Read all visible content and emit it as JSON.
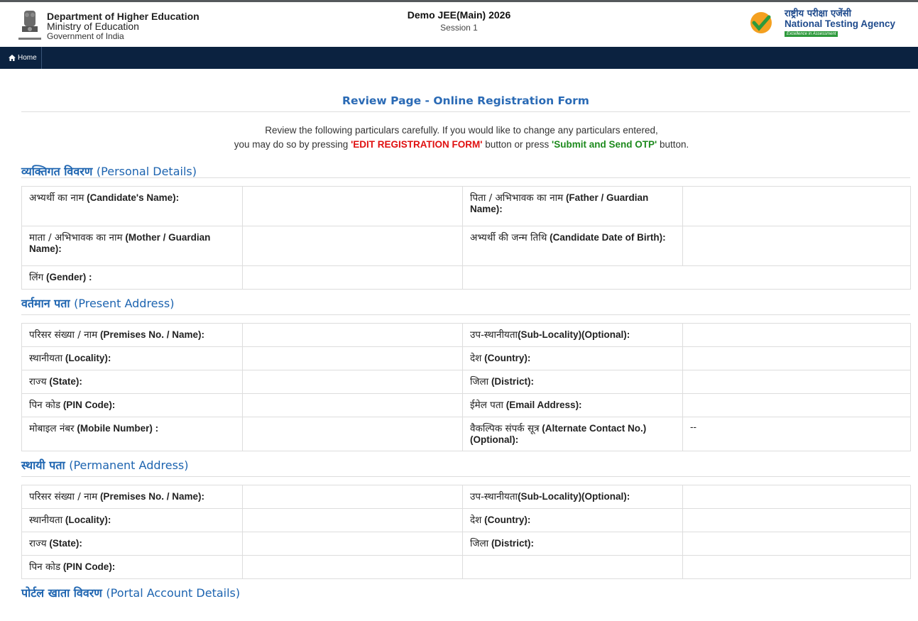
{
  "header": {
    "dept_line1": "Department of Higher Education",
    "dept_line2": "Ministry of Education",
    "dept_line3": "Government of India",
    "exam_title": "Demo JEE(Main) 2026",
    "session": "Session 1",
    "nta_hindi": "राष्ट्रीय परीक्षा एजेंसी",
    "nta_english": "National Testing Agency",
    "nta_tagline": "Excellence in Assessment"
  },
  "nav": {
    "home_label": "Home"
  },
  "page_title": "Review Page - Online Registration Form",
  "intro": {
    "line1": "Review the following particulars carefully. If you would like to change any particulars entered,",
    "line2_pre": "you may do so by pressing ",
    "edit_btn_text": "'EDIT REGISTRATION FORM'",
    "line2_mid": " button or press  ",
    "submit_btn_text": "'Submit and Send OTP'",
    "line2_post": " button."
  },
  "personal": {
    "heading_hi": "व्यक्तिगत विवरण",
    "heading_en": "(Personal Details)",
    "candidate_name_hi": "अभ्यर्थी का नाम",
    "candidate_name_en": "(Candidate's Name):",
    "father_hi": "पिता / अभिभावक का नाम",
    "father_en": "(Father / Guardian Name):",
    "mother_hi": "माता / अभिभावक का नाम",
    "mother_en": "(Mother / Guardian Name):",
    "dob_hi": "अभ्यर्थी की जन्म तिथि",
    "dob_en": "(Candidate Date of Birth):",
    "gender_hi": "लिंग",
    "gender_en": "(Gender) :"
  },
  "present": {
    "heading_hi": "वर्तमान पता",
    "heading_en": "(Present Address)",
    "premises_hi": "परिसर संख्या / नाम",
    "premises_en": "(Premises No. / Name):",
    "sublocality_hi": "उप-स्थानीयता",
    "sublocality_en": "(Sub-Locality)(Optional):",
    "locality_hi": "स्थानीयता",
    "locality_en": "(Locality):",
    "country_hi": "देश",
    "country_en": "(Country):",
    "state_hi": "राज्य",
    "state_en": "(State):",
    "district_hi": "जिला",
    "district_en": "(District):",
    "pin_hi": "पिन कोड",
    "pin_en": "(PIN Code):",
    "email_hi": "ईमेल पता",
    "email_en": "(Email Address):",
    "mobile_hi": "मोबाइल नंबर",
    "mobile_en": "(Mobile Number) :",
    "alt_hi": "वैकल्पिक संपर्क सूत्र",
    "alt_en": "(Alternate Contact No.) (Optional):",
    "alt_value": "--"
  },
  "permanent": {
    "heading_hi": "स्थायी पता",
    "heading_en": "(Permanent Address)",
    "premises_hi": "परिसर संख्या / नाम",
    "premises_en": "(Premises No. / Name):",
    "sublocality_hi": "उप-स्थानीयता",
    "sublocality_en": "(Sub-Locality)(Optional):",
    "locality_hi": "स्थानीयता",
    "locality_en": "(Locality):",
    "country_hi": "देश",
    "country_en": "(Country):",
    "state_hi": "राज्य",
    "state_en": "(State):",
    "district_hi": "जिला",
    "district_en": "(District):",
    "pin_hi": "पिन कोड",
    "pin_en": "(PIN Code):"
  },
  "portal": {
    "heading_hi": "पोर्टल खाता विवरण",
    "heading_en": "(Portal Account Details)"
  },
  "colors": {
    "nav_bg": "#0b2240",
    "title_blue": "#2a6ab5",
    "section_blue": "#1d64b0",
    "edit_red": "#e01010",
    "submit_green": "#1d8a1d"
  }
}
